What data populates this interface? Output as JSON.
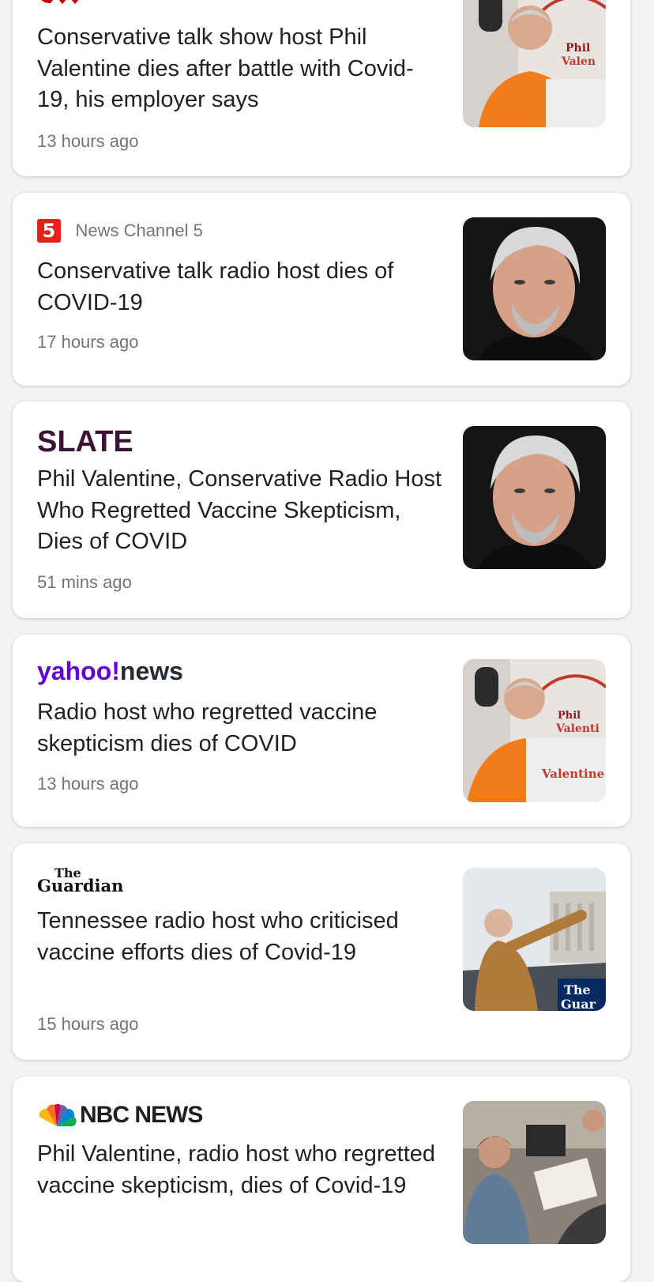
{
  "articles": [
    {
      "source": "CNN",
      "headline": "Conservative talk show host Phil Valentine dies after battle with Covid-19, his employer says",
      "time": "13 hours ago",
      "image": "radio-host-photo"
    },
    {
      "source": "News Channel 5",
      "headline": "Conservative talk radio host dies of COVID-19",
      "time": "17 hours ago",
      "image": "portrait-photo"
    },
    {
      "source": "SLATE",
      "headline": "Phil Valentine, Conservative Radio Host Who Regretted Vaccine Skepticism, Dies of COVID",
      "time": "51 mins ago",
      "image": "portrait-photo"
    },
    {
      "source": "yahoo!news",
      "headline": "Radio host who regretted vaccine skepticism dies of COVID",
      "time": "13 hours ago",
      "image": "radio-host-photo"
    },
    {
      "source": "The Guardian",
      "headline": "Tennessee radio host who criticised vaccine efforts dies of Covid-19",
      "time": "15 hours ago",
      "image": "rally-photo"
    },
    {
      "source": "NBC NEWS",
      "headline": "Phil Valentine, radio host who regretted vaccine skepticism, dies of Covid-19",
      "time": "",
      "image": "studio-photo"
    }
  ],
  "logo_text": {
    "ch5_numeral": "5",
    "yahoo_part": "yahoo!",
    "news_part": "news",
    "guardian_the": "The",
    "guardian_name": "Guardian",
    "nbc": "NBC NEWS"
  },
  "colors": {
    "cnn_red": "#cc0000",
    "ch5_red": "#e2231a",
    "slate_purple": "#3c1236",
    "yahoo_purple": "#6001d2",
    "guardian_navy": "#052962"
  }
}
